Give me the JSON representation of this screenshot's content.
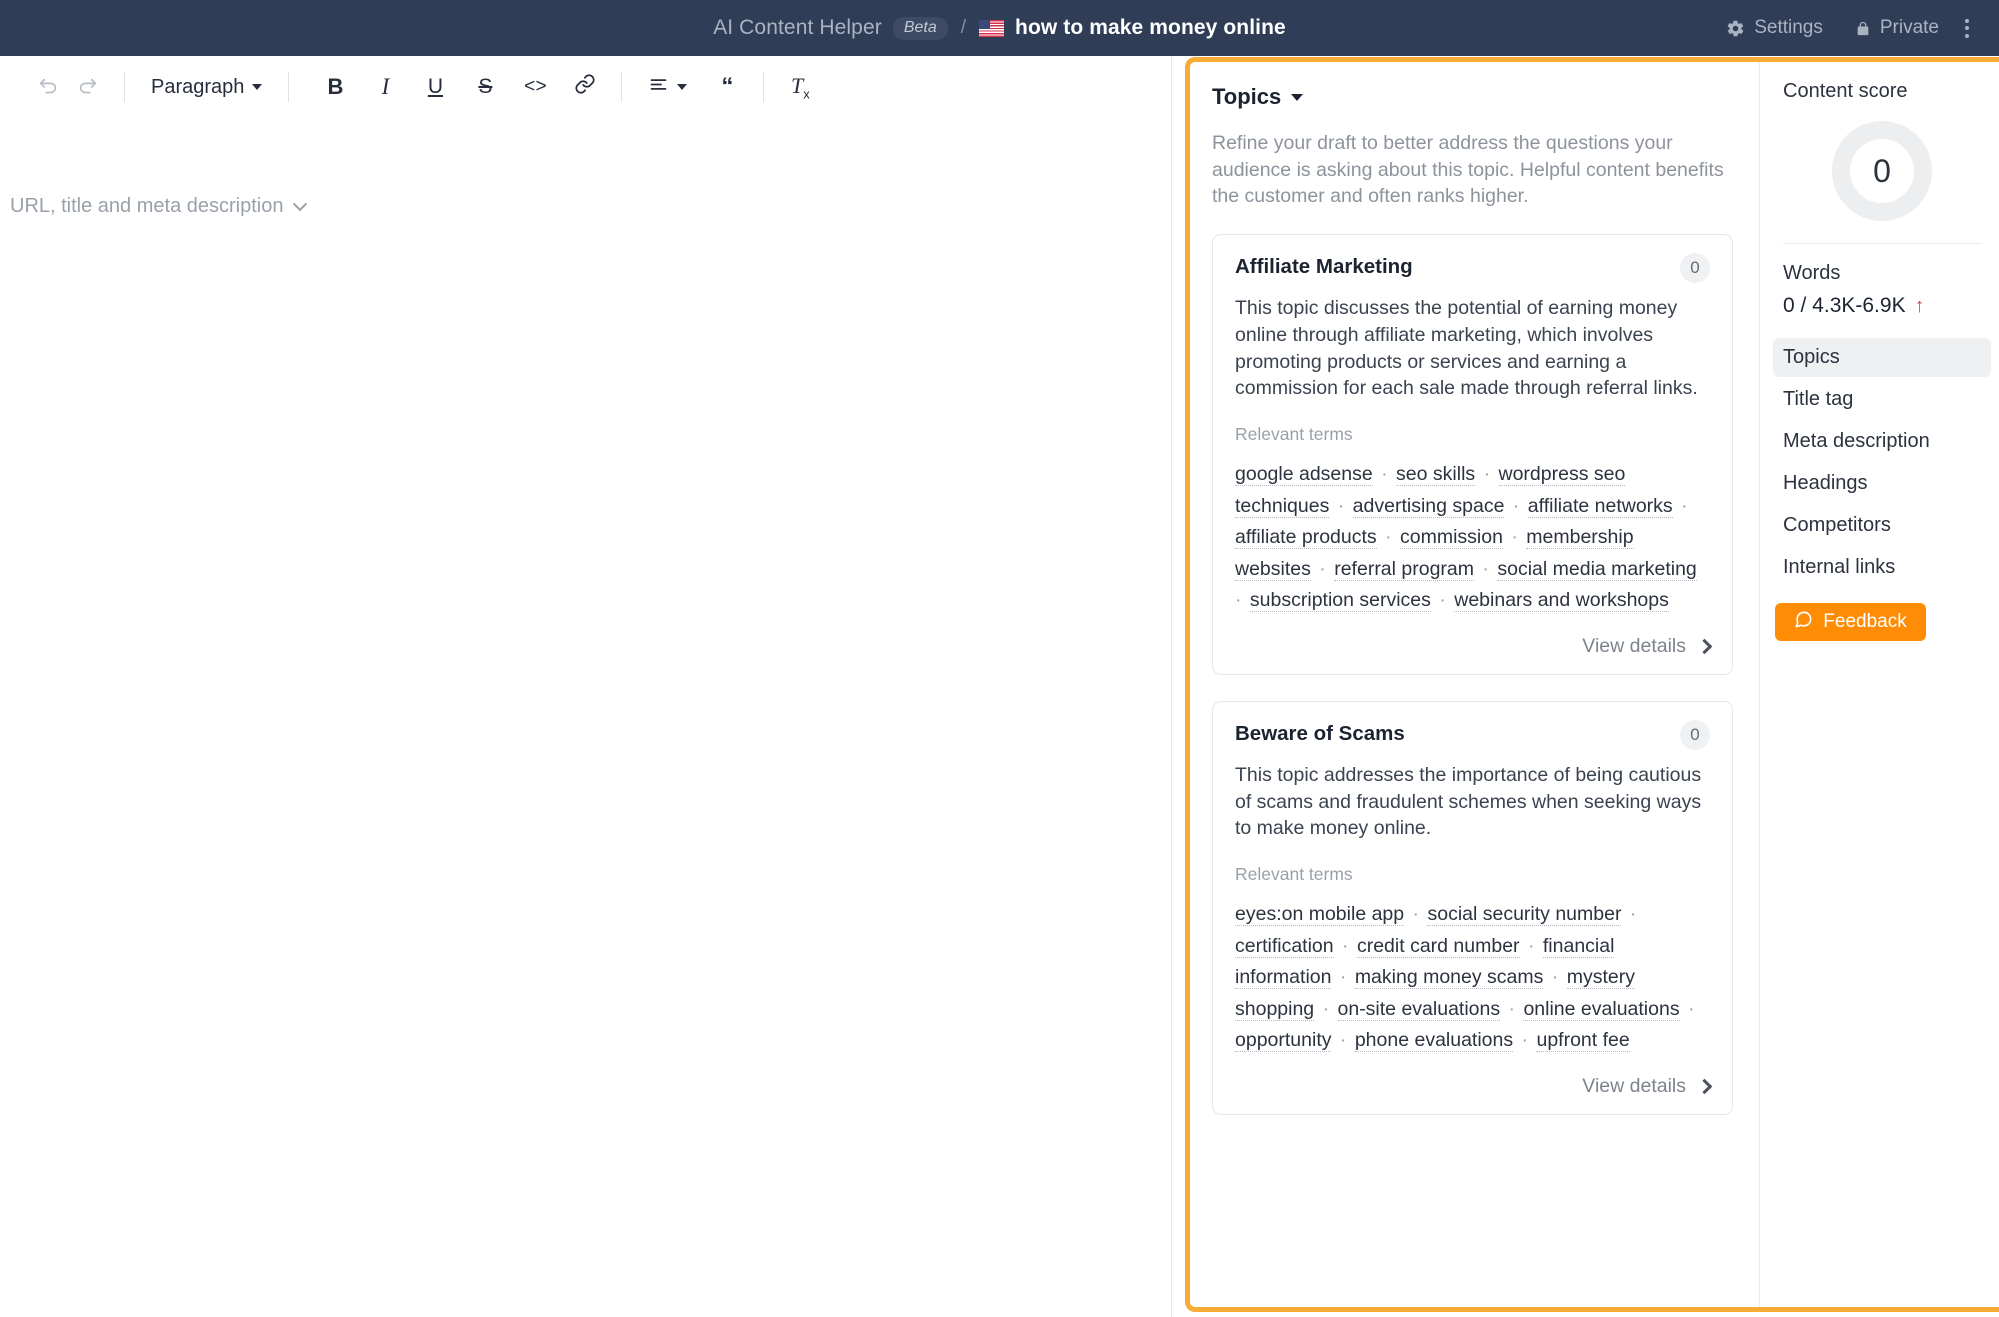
{
  "topbar": {
    "app_name": "AI Content Helper",
    "beta_label": "Beta",
    "separator": "/",
    "flag_icon": "us-flag-icon",
    "doc_title": "how to make money online",
    "settings_label": "Settings",
    "settings_icon": "gear-icon",
    "privacy_label": "Private",
    "privacy_icon": "lock-icon",
    "more_icon": "kebab-menu-icon",
    "bg_color": "#2f3d56"
  },
  "editor": {
    "toolbar": {
      "undo_icon": "undo-icon",
      "redo_icon": "redo-icon",
      "block_style": "Paragraph",
      "bold_label": "B",
      "italic_label": "I",
      "underline_label": "U",
      "strike_label": "S",
      "code_label": "<>",
      "link_icon": "link-icon",
      "align_icon": "align-left-icon",
      "quote_label": "“",
      "clear_format_label": "Tx"
    },
    "meta_toggle": "URL, title and meta description"
  },
  "topics_panel": {
    "header": "Topics",
    "description": "Refine your draft to better address the questions your audience is asking about this topic. Helpful content benefits the customer and often ranks higher.",
    "relevant_terms_label": "Relevant terms",
    "view_details_label": "View details",
    "cards": [
      {
        "title": "Affiliate Marketing",
        "count": "0",
        "description": "This topic discusses the potential of earning money online through affiliate marketing, which involves promoting products or services and earning a commission for each sale made through referral links.",
        "terms": [
          "google adsense",
          "seo skills",
          "wordpress seo techniques",
          "advertising space",
          "affiliate networks",
          "affiliate products",
          "commission",
          "membership websites",
          "referral program",
          "social media marketing",
          "subscription services",
          "webinars and workshops"
        ]
      },
      {
        "title": "Beware of Scams",
        "count": "0",
        "description": "This topic addresses the importance of being cautious of scams and fraudulent schemes when seeking ways to make money online.",
        "terms": [
          "eyes:on mobile app",
          "social security number",
          "certification",
          "credit card number",
          "financial information",
          "making money scams",
          "mystery shopping",
          "on-site evaluations",
          "online evaluations",
          "opportunity",
          "phone evaluations",
          "upfront fee"
        ]
      }
    ]
  },
  "score_panel": {
    "content_score_label": "Content score",
    "content_score_value": "0",
    "words_label": "Words",
    "words_value": "0 / 4.3K-6.9K",
    "words_trend_icon": "up-arrow-icon",
    "nav_items": [
      {
        "label": "Topics",
        "active": true
      },
      {
        "label": "Title tag",
        "active": false
      },
      {
        "label": "Meta description",
        "active": false
      },
      {
        "label": "Headings",
        "active": false
      },
      {
        "label": "Competitors",
        "active": false
      },
      {
        "label": "Internal links",
        "active": false
      }
    ],
    "feedback_label": "Feedback",
    "feedback_icon": "speech-bubble-icon",
    "feedback_color": "#ff8c05",
    "highlight_color": "#f9ab38"
  }
}
